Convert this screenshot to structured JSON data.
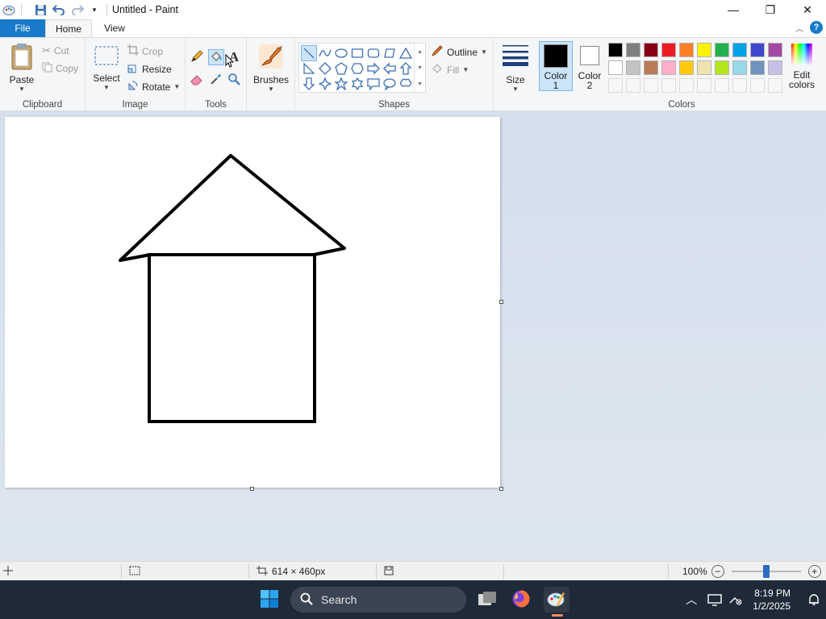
{
  "window": {
    "title": "Untitled - Paint",
    "minimize_glyph": "—",
    "restore_glyph": "❐",
    "close_glyph": "✕"
  },
  "tabs": [
    {
      "label": "File"
    },
    {
      "label": "Home"
    },
    {
      "label": "View"
    }
  ],
  "ribbon": {
    "clipboard": {
      "label": "Clipboard",
      "paste": "Paste",
      "cut": "Cut",
      "copy": "Copy"
    },
    "image": {
      "label": "Image",
      "select": "Select",
      "crop": "Crop",
      "resize": "Resize",
      "rotate": "Rotate"
    },
    "tools": {
      "label": "Tools",
      "text_glyph": "A"
    },
    "brushes": {
      "label": "Brushes"
    },
    "shapes": {
      "label": "Shapes",
      "outline": "Outline",
      "fill": "Fill"
    },
    "size": {
      "label": "Size"
    },
    "colors": {
      "label": "Colors",
      "color1_line1": "Color",
      "color1_line2": "1",
      "color2_line1": "Color",
      "color2_line2": "2",
      "edit_line1": "Edit",
      "edit_line2": "colors",
      "color1_value": "#000000",
      "color2_value": "#ffffff",
      "palette_row1": [
        "#000000",
        "#7f7f7f",
        "#880015",
        "#ed1c24",
        "#ff7f27",
        "#fff200",
        "#22b14c",
        "#00a2e8",
        "#3f48cc",
        "#a349a4"
      ],
      "palette_row2": [
        "#ffffff",
        "#c3c3c3",
        "#b97a57",
        "#ffaec9",
        "#ffc90e",
        "#efe4b0",
        "#b5e61d",
        "#99d9ea",
        "#7092be",
        "#c8bfe7"
      ]
    }
  },
  "canvas": {
    "stroke_color": "#000000"
  },
  "statusbar": {
    "dimensions": "614 × 460px",
    "zoom": "100%",
    "zoom_fraction": 0.5
  },
  "taskbar": {
    "search_label": "Search",
    "time": "8:19 PM",
    "date": "1/2/2025"
  }
}
